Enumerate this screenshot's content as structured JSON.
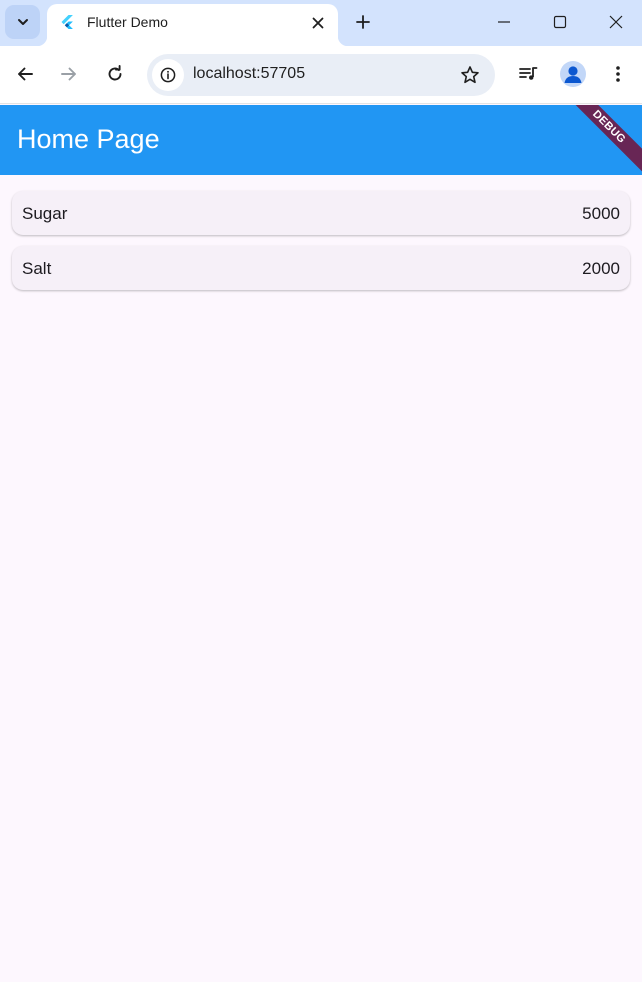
{
  "browser": {
    "tab": {
      "title": "Flutter Demo",
      "favicon": "flutter-logo-icon"
    },
    "address_bar": {
      "url": "localhost:57705"
    },
    "icons": {
      "tab_search": "chevron-down-icon",
      "tab_close": "close-icon",
      "new_tab": "plus-icon",
      "minimize": "minimize-icon",
      "maximize": "maximize-icon",
      "close_window": "close-icon",
      "back": "arrow-left-icon",
      "forward": "arrow-right-icon",
      "reload": "reload-icon",
      "site_info": "info-icon",
      "bookmark": "star-icon",
      "media": "playlist-music-icon",
      "profile": "person-icon",
      "menu": "more-vert-icon"
    }
  },
  "app": {
    "title": "Home Page",
    "debug_banner": "DEBUG",
    "items": [
      {
        "name": "Sugar",
        "qty": "5000"
      },
      {
        "name": "Salt",
        "qty": "2000"
      }
    ]
  },
  "colors": {
    "appbar": "#2196f3",
    "background": "#fdf7fe",
    "card": "#f6f0f8",
    "tabstrip": "#d3e3fd"
  }
}
